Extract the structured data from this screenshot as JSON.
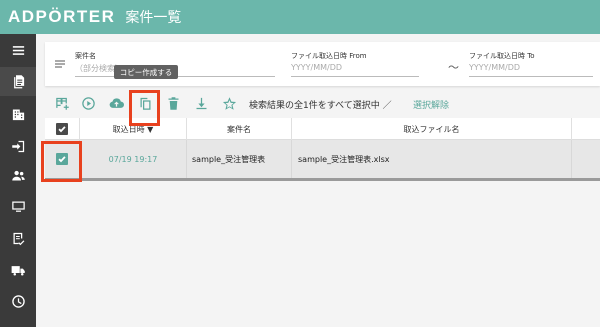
{
  "app": {
    "logo": "ADPÖRTER",
    "page_title": "案件一覧"
  },
  "sidebar": {
    "items": [
      {
        "icon": "menu-icon"
      },
      {
        "icon": "document-icon",
        "active": true
      },
      {
        "icon": "building-icon"
      },
      {
        "icon": "login-icon"
      },
      {
        "icon": "people-icon"
      },
      {
        "icon": "monitor-icon"
      },
      {
        "icon": "checklist-icon"
      },
      {
        "icon": "truck-icon"
      },
      {
        "icon": "history-icon"
      }
    ]
  },
  "search": {
    "project_name_label": "案件名",
    "project_name_placeholder": "（部分検索）",
    "from_label": "ファイル取込日時 From",
    "from_placeholder": "YYYY/MM/DD",
    "tilde": "〜",
    "to_label": "ファイル取込日時 To",
    "to_placeholder": "YYYY/MM/DD"
  },
  "tooltip": {
    "text": "コピー作成する"
  },
  "toolbar": {
    "select_all_text": "検索結果の全1件をすべて選択中 ／",
    "deselect_link": "選択解除"
  },
  "table": {
    "columns": [
      "",
      "取込日時 ▼",
      "案件名",
      "取込ファイル名",
      ""
    ],
    "rows": [
      {
        "checked": true,
        "imported_at": "07/19 19:17",
        "project_name": "sample_受注管理表",
        "file_name": "sample_受注管理表.xlsx"
      }
    ]
  },
  "colors": {
    "accent": "#6bb7ab",
    "sidebar": "#3a3a3a",
    "highlight": "#e8411e"
  }
}
